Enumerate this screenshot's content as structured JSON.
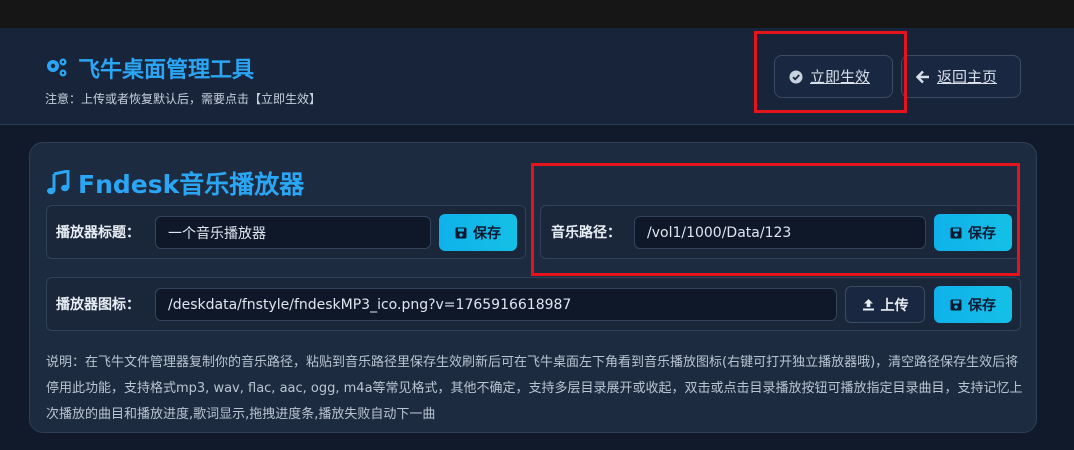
{
  "header": {
    "title": "飞牛桌面管理工具",
    "note": "注意：上传或者恢复默认后，需要点击【立即生效】",
    "apply_label": "立即生效",
    "home_label": "返回主页"
  },
  "card": {
    "title": "Fndesk音乐播放器",
    "player_title": {
      "label": "播放器标题：",
      "value": "一个音乐播放器",
      "save_label": "保存"
    },
    "music_path": {
      "label": "音乐路径：",
      "value": "/vol1/1000/Data/123",
      "save_label": "保存"
    },
    "player_icon": {
      "label": "播放器图标：",
      "value": "/deskdata/fnstyle/fndeskMP3_ico.png?v=1765916618987",
      "upload_label": "上传",
      "save_label": "保存"
    },
    "description": "说明：在飞牛文件管理器复制你的音乐路径，粘贴到音乐路径里保存生效刷新后可在飞牛桌面左下角看到音乐播放图标(右键可打开独立播放器哦)，清空路径保存生效后将停用此功能，支持格式mp3, wav, flac, aac, ogg, m4a等常见格式，其他不确定，支持多层目录展开或收起，双击或点击目录播放按钮可播放指定目录曲目，支持记忆上次播放的曲目和播放进度,歌词显示,拖拽进度条,播放失败自动下一曲"
  },
  "icons": [
    "gears-icon",
    "check-circle-icon",
    "arrow-left-icon",
    "music-icon",
    "floppy-icon",
    "upload-icon"
  ],
  "colors": {
    "accent": "#2aa6f5",
    "save_button": "#0fb1ea",
    "highlight": "#e4141a"
  }
}
